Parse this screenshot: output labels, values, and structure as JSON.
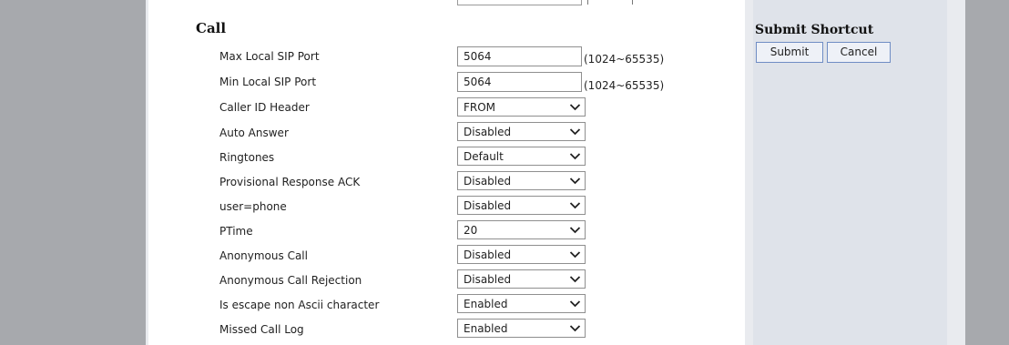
{
  "section": {
    "title": "Call"
  },
  "fields": {
    "max_local_sip_port": {
      "label": "Max Local SIP Port",
      "value": "5064",
      "range": "(1024~65535)"
    },
    "min_local_sip_port": {
      "label": "Min Local SIP Port",
      "value": "5064",
      "range": "(1024~65535)"
    },
    "caller_id_header": {
      "label": "Caller ID Header",
      "value": "FROM"
    },
    "auto_answer": {
      "label": "Auto Answer",
      "value": "Disabled"
    },
    "ringtones": {
      "label": "Ringtones",
      "value": "Default"
    },
    "provisional_response_ack": {
      "label": "Provisional Response ACK",
      "value": "Disabled"
    },
    "user_phone": {
      "label": "user=phone",
      "value": "Disabled"
    },
    "ptime": {
      "label": "PTime",
      "value": "20"
    },
    "anonymous_call": {
      "label": "Anonymous Call",
      "value": "Disabled"
    },
    "anonymous_call_rejection": {
      "label": "Anonymous Call Rejection",
      "value": "Disabled"
    },
    "escape_non_ascii": {
      "label": "Is escape non Ascii character",
      "value": "Enabled"
    },
    "missed_call_log": {
      "label": "Missed Call Log",
      "value": "Enabled"
    }
  },
  "shortcut": {
    "title": "Submit Shortcut",
    "submit_label": "Submit",
    "cancel_label": "Cancel"
  },
  "icons": {
    "dropdown": "chevron-down-icon"
  },
  "colors": {
    "page_bg": "#a7a9ad",
    "content_bg": "#ffffff",
    "side_bg": "#dfe3ea",
    "button_border": "#6f8dc4"
  }
}
